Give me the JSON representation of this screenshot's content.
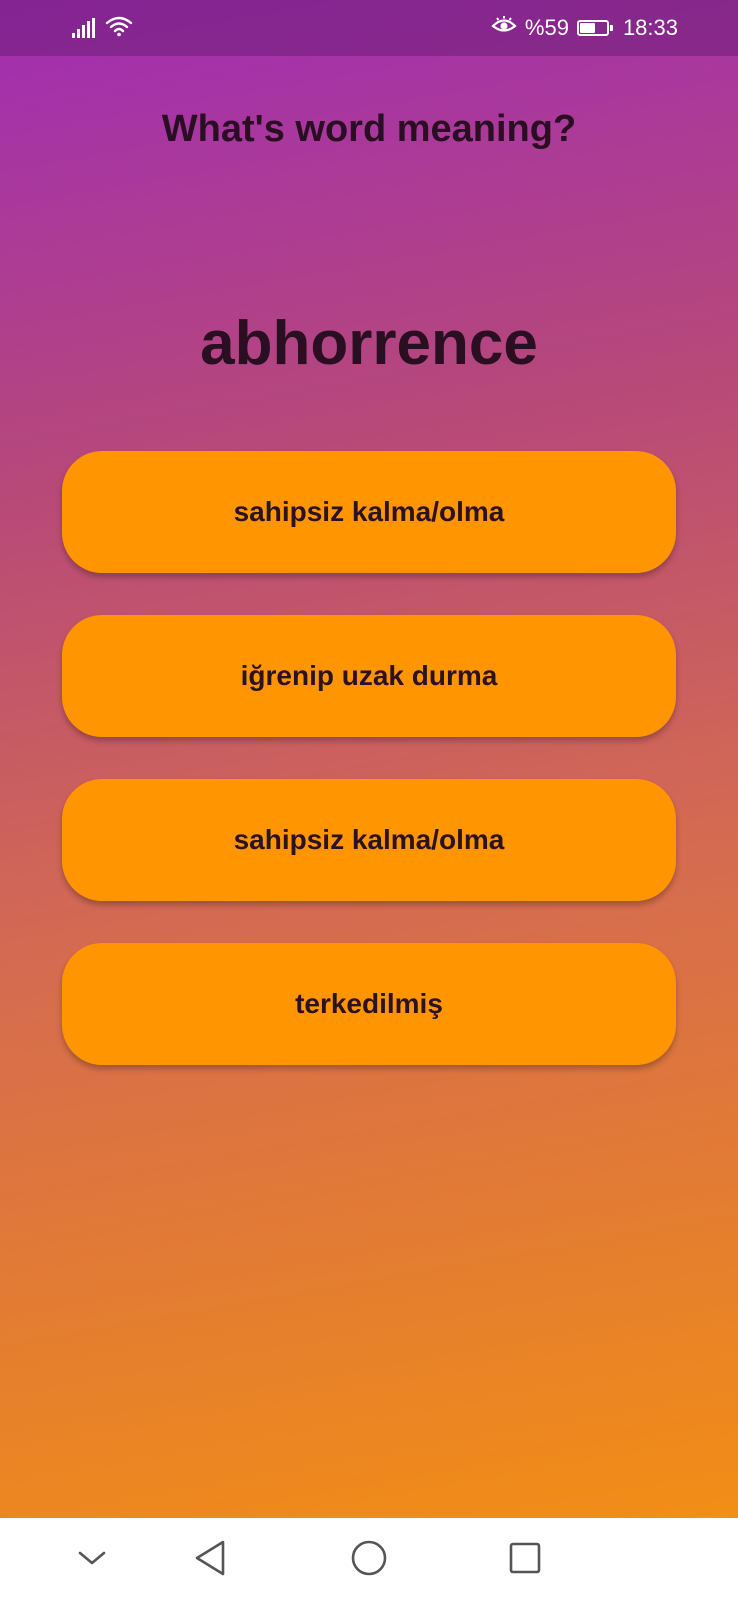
{
  "status_bar": {
    "battery_text": "%59",
    "battery_level": 0.59,
    "time": "18:33",
    "icons": [
      "signal-icon",
      "wifi-icon",
      "eye-comfort-icon",
      "battery-icon"
    ]
  },
  "quiz": {
    "question": "What's word meaning?",
    "word": "abhorrence",
    "options": [
      "sahipsiz kalma/olma",
      "iğrenip uzak durma",
      "sahipsiz kalma/olma",
      "terkedilmiş"
    ]
  },
  "nav_bar": {
    "icons": [
      "chevron-down-icon",
      "back-triangle-icon",
      "home-circle-icon",
      "recents-square-icon"
    ]
  },
  "colors": {
    "button": "#ff9500",
    "text_dark": "#2a0e22",
    "gradient_top": "#a12db4",
    "gradient_bottom": "#f7920e"
  }
}
